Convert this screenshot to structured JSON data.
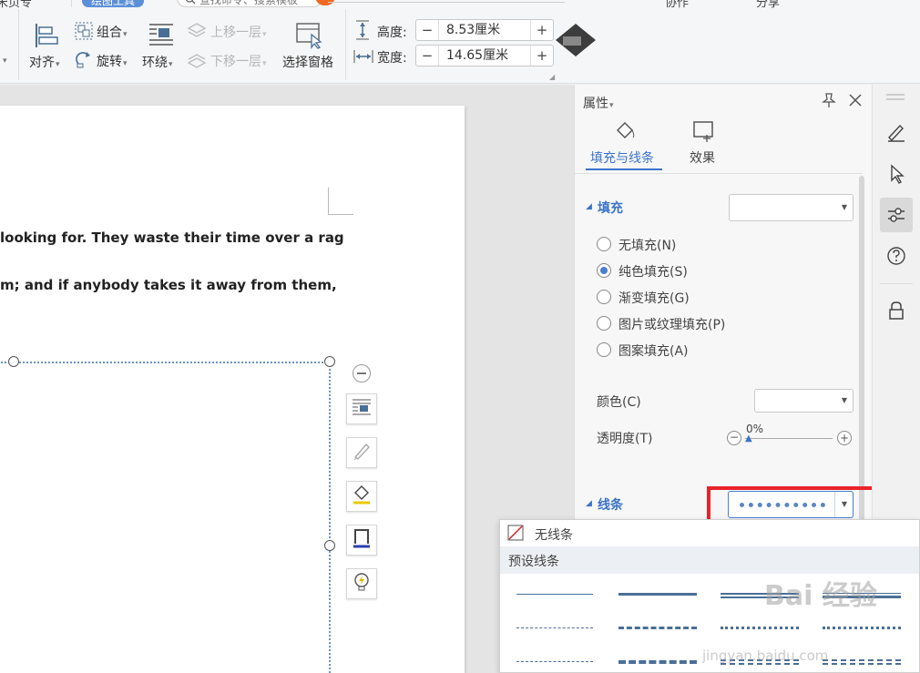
{
  "ribbon": {
    "tab_cut": "宋页专",
    "tab_active": "绘图工具",
    "search_placeholder": "查找命令、搜索模板",
    "right_tabs": [
      "协作",
      "分享"
    ],
    "groups": {
      "align": "对齐",
      "group": "组合",
      "rotate": "旋转",
      "wrap": "环绕",
      "bring_forward": "上移一层",
      "send_backward": "下移一层",
      "selection_pane": "选择窗格"
    },
    "size": {
      "height_label": "高度:",
      "height_value": "8.53厘米",
      "width_label": "宽度:",
      "width_value": "14.65厘米",
      "minus": "−",
      "plus": "+"
    }
  },
  "document": {
    "line1": "looking for. They waste their time over a rag",
    "line2": "m; and if anybody takes it away from them,"
  },
  "panel": {
    "title": "属性",
    "tabs": [
      "填充与线条",
      "效果"
    ],
    "fill_section": "填充",
    "fill_options": [
      "无填充(N)",
      "纯色填充(S)",
      "渐变填充(G)",
      "图片或纹理填充(P)",
      "图案填充(A)"
    ],
    "fill_selected_index": 1,
    "color_label": "颜色(C)",
    "transparency_label": "透明度(T)",
    "transparency_value": "0%",
    "line_section": "线条"
  },
  "line_dropdown": {
    "no_line": "无线条",
    "preset_header": "预设线条"
  },
  "watermark": {
    "text": "Bai 经验",
    "url": "jingyan.baidu.com"
  },
  "colors": {
    "accent": "#4a7fd0",
    "highlight_box": "#e8242a",
    "line_blue": "#4a6f96",
    "dotted_blue": "#5b86c4"
  }
}
